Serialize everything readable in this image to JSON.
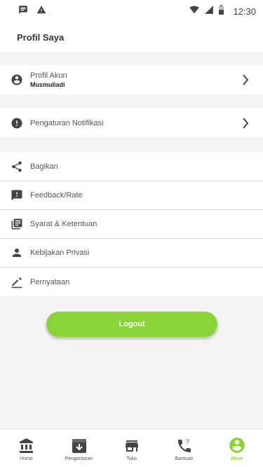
{
  "status_bar": {
    "time": "12:30",
    "left_icons": [
      "message-icon",
      "warning-icon"
    ],
    "right_icons": [
      "wifi-icon",
      "signal-icon",
      "battery-icon"
    ]
  },
  "header": {
    "title": "Profil Saya"
  },
  "profile": {
    "label": "Profil Akun",
    "username": "Musmuliadi",
    "icon": "account-circle-icon"
  },
  "notification": {
    "label": "Pengaturan Notifikasi",
    "icon": "alert-circle-icon"
  },
  "menu": {
    "items": [
      {
        "label": "Bagikan",
        "icon": "share-icon"
      },
      {
        "label": "Feedback/Rate",
        "icon": "feedback-icon"
      },
      {
        "label": "Syarat & Ketentuan",
        "icon": "library-books-icon"
      },
      {
        "label": "Kebijakan Privasi",
        "icon": "person-icon"
      },
      {
        "label": "Pernyataan",
        "icon": "edit-icon"
      }
    ]
  },
  "logout": {
    "label": "Logout"
  },
  "bottom_nav": {
    "items": [
      {
        "label": "Home",
        "icon": "bank-icon",
        "active": false
      },
      {
        "label": "Pengantaran",
        "icon": "download-box-icon",
        "active": false
      },
      {
        "label": "Toko",
        "icon": "store-icon",
        "active": false
      },
      {
        "label": "Bantuan",
        "icon": "phone-help-icon",
        "active": false
      },
      {
        "label": "Akun",
        "icon": "account-circle-icon",
        "active": true
      }
    ]
  },
  "colors": {
    "accent": "#8ad43a",
    "icon": "#444444",
    "background": "#f5f5f5"
  }
}
